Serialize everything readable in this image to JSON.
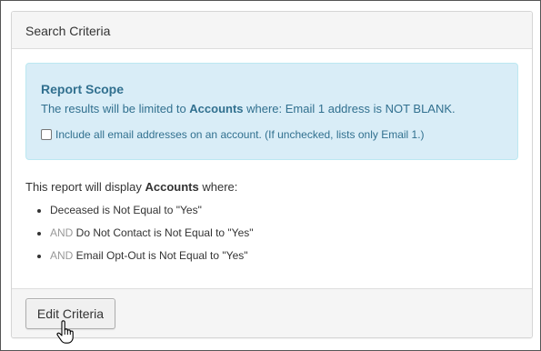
{
  "panel": {
    "heading": "Search Criteria"
  },
  "scope": {
    "title": "Report Scope",
    "desc_prefix": "The results will be limited to ",
    "desc_entity": "Accounts",
    "desc_suffix": " where: Email 1 address is NOT BLANK.",
    "checkbox_label": "Include all email addresses on an account. (If unchecked, lists only Email 1.)",
    "checkbox_checked": false
  },
  "display": {
    "prefix": "This report will display ",
    "entity": "Accounts",
    "suffix": " where:"
  },
  "criteria": [
    {
      "conj": "",
      "text": "Deceased is Not Equal to \"Yes\""
    },
    {
      "conj": "AND ",
      "text": "Do Not Contact is Not Equal to \"Yes\""
    },
    {
      "conj": "AND ",
      "text": "Email Opt-Out is Not Equal to \"Yes\""
    }
  ],
  "footer": {
    "edit_button": "Edit Criteria"
  },
  "colors": {
    "info_bg": "#d9edf7",
    "info_text": "#31708f",
    "muted": "#999999"
  },
  "icons": {
    "cursor": "hand-pointer-icon"
  }
}
